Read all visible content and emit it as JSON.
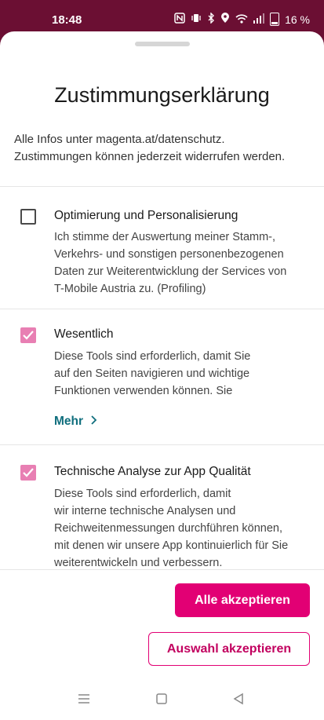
{
  "status": {
    "time": "18:48",
    "battery": "16 %"
  },
  "dialog": {
    "title": "Zustimmungserklärung",
    "intro_line1": "Alle Infos unter magenta.at/datenschutz.",
    "intro_line2": "Zustimmungen können jederzeit widerrufen werden."
  },
  "items": [
    {
      "title": "Optimierung und Personalisierung",
      "checked": false,
      "desc_lines": [
        "Ich stimme der Auswertung meiner Stamm-,",
        "Verkehrs- und sonstigen personenbezogenen",
        "Daten zur Weiterentwicklung der Services von",
        "T-Mobile Austria zu. (Profiling)"
      ]
    },
    {
      "title": "Wesentlich",
      "checked": true,
      "desc_lines": [
        "Diese Tools sind erforderlich, damit Sie",
        "auf den Seiten navigieren und wichtige",
        "Funktionen verwenden können. Sie"
      ],
      "more_label": "Mehr"
    },
    {
      "title": "Technische Analyse zur App Qualität",
      "checked": true,
      "desc_lines": [
        "Diese Tools sind erforderlich, damit",
        "wir interne technische Analysen und",
        "Reichweitenmessungen durchführen können,",
        "mit denen wir unsere App kontinuierlich für Sie",
        "weiterentwickeln und verbessern."
      ]
    }
  ],
  "buttons": {
    "accept_all": "Alle akzeptieren",
    "accept_selection": "Auswahl akzeptieren"
  },
  "colors": {
    "brand": "#e20074",
    "checkbox_checked": "#e87fb3",
    "link": "#0f6e7d",
    "statusbar": "#6b0f33"
  },
  "icons": [
    "nfc-icon",
    "vibrate-icon",
    "bluetooth-icon",
    "location-icon",
    "wifi-icon",
    "signal-icon",
    "battery-icon",
    "check-icon",
    "chevron-right-icon",
    "menu-icon",
    "home-icon",
    "back-icon"
  ]
}
